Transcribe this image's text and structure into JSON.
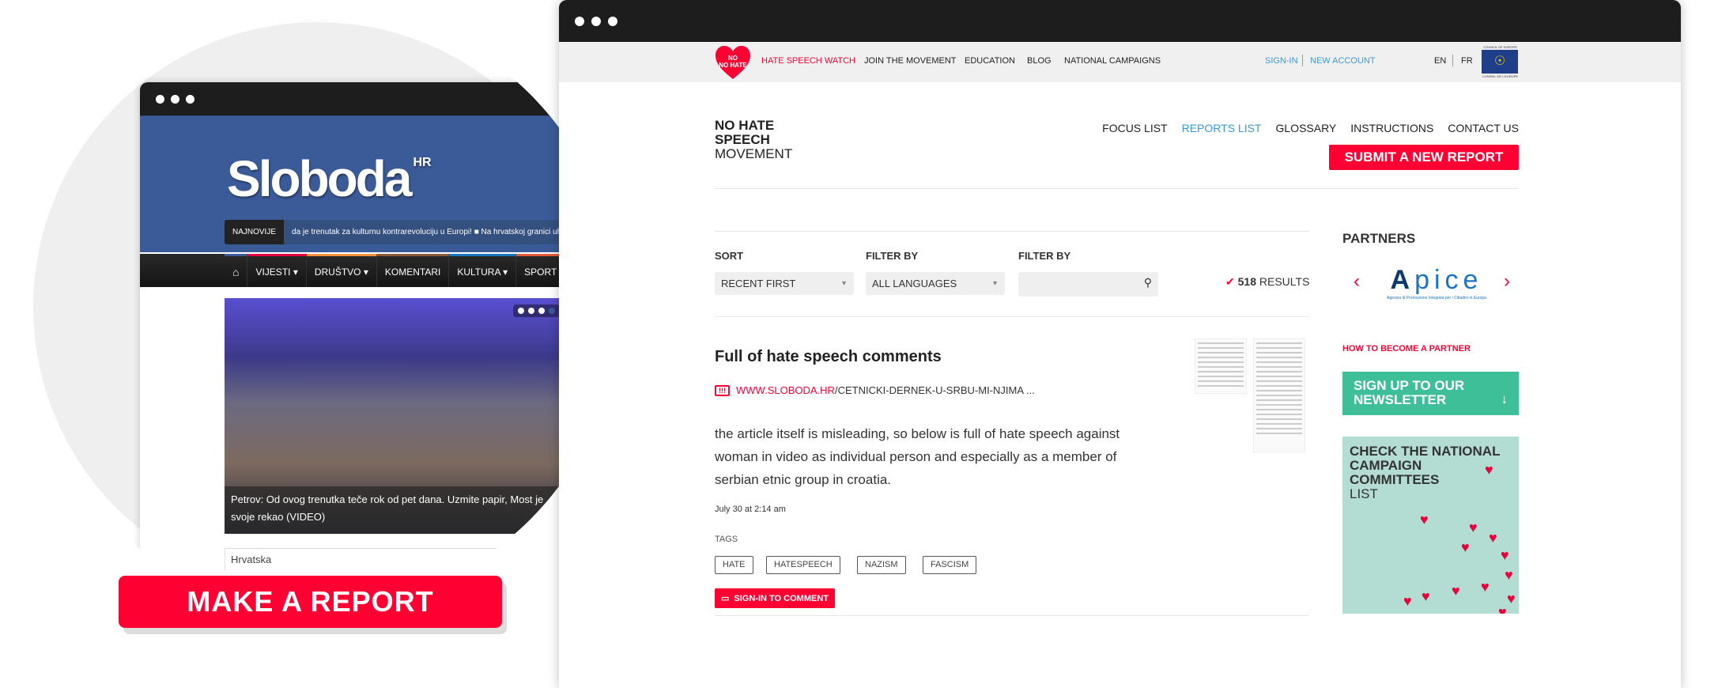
{
  "left_site": {
    "logo": "Sloboda",
    "logo_sup": "HR",
    "ticker_label": "NAJNOVIJE",
    "ticker_text": "da je trenutak za kulturnu kontrarevoluciju u Europi!  ■ Na hrvatskoj granici uhićen",
    "nav": [
      "VIJESTI ▾",
      "DRUŠTVO ▾",
      "KOMENTARI",
      "KULTURA ▾",
      "SPORT ▾"
    ],
    "nav_colors": [
      "#e8003d",
      "#f7913d",
      "#8a5a3b",
      "#1b75bb",
      "#e55a3b"
    ],
    "photo_caption": "Petrov: Od ovog trenutka teče rok od pet dana. Uzmite papir, Most je svoje rekao (VIDEO)",
    "section": "Hrvatska"
  },
  "make_report_label": "MAKE A REPORT",
  "top_nav": {
    "logo_text": "NO HATE",
    "items": [
      "HATE SPEECH WATCH",
      "JOIN THE MOVEMENT",
      "EDUCATION",
      "BLOG",
      "NATIONAL CAMPAIGNS"
    ],
    "sign_in": "SIGN-IN",
    "new_account": "NEW ACCOUNT",
    "langs": [
      "EN",
      "FR"
    ],
    "coe_top": "COUNCIL OF EUROPE",
    "coe_bottom": "CONSEIL DE L'EUROPE"
  },
  "brand": {
    "line1": "NO HATE",
    "line2": "SPEECH",
    "line3": "MOVEMENT"
  },
  "sub_nav": [
    "FOCUS LIST",
    "REPORTS LIST",
    "GLOSSARY",
    "INSTRUCTIONS",
    "CONTACT US"
  ],
  "submit_label": "SUBMIT A NEW REPORT",
  "filters": {
    "sort_label": "SORT",
    "sort_value": "RECENT FIRST",
    "filter1_label": "FILTER BY",
    "filter1_value": "ALL LANGUAGES",
    "filter2_label": "FILTER BY",
    "filter2_value": "",
    "results_count": "518",
    "results_label": "RESULTS"
  },
  "report": {
    "title": "Full of hate speech comments",
    "url_domain": "WWW.SLOBODA.HR",
    "url_path": "/CETNICKI-DERNEK-U-SRBU-MI-NJIMA ...",
    "body": "the article itself is misleading, so below is full of hate speech against woman in video as individual person and especially as a member of serbian etnic group in croatia.",
    "date": "July 30 at 2:14 am",
    "tags_label": "TAGS",
    "tags": [
      "HATE",
      "HATESPEECH",
      "NAZISM",
      "FASCISM"
    ],
    "comment_label": "SIGN-IN TO COMMENT"
  },
  "sidebar": {
    "partners_title": "PARTNERS",
    "partner_name": "Apice",
    "partner_tagline": "Agenzia di Promozione Integrata per i Cittadini in Europa",
    "become_partner": "HOW TO BECOME A PARTNER",
    "newsletter": "SIGN UP TO OUR NEWSLETTER",
    "campaign_title": "CHECK THE NATIONAL CAMPAIGN COMMITTEES",
    "campaign_list": "LIST"
  },
  "colors": {
    "accent": "#ff0033",
    "link": "#3a9ad9",
    "green": "#3fbf98",
    "map": "#b3ddd3"
  }
}
